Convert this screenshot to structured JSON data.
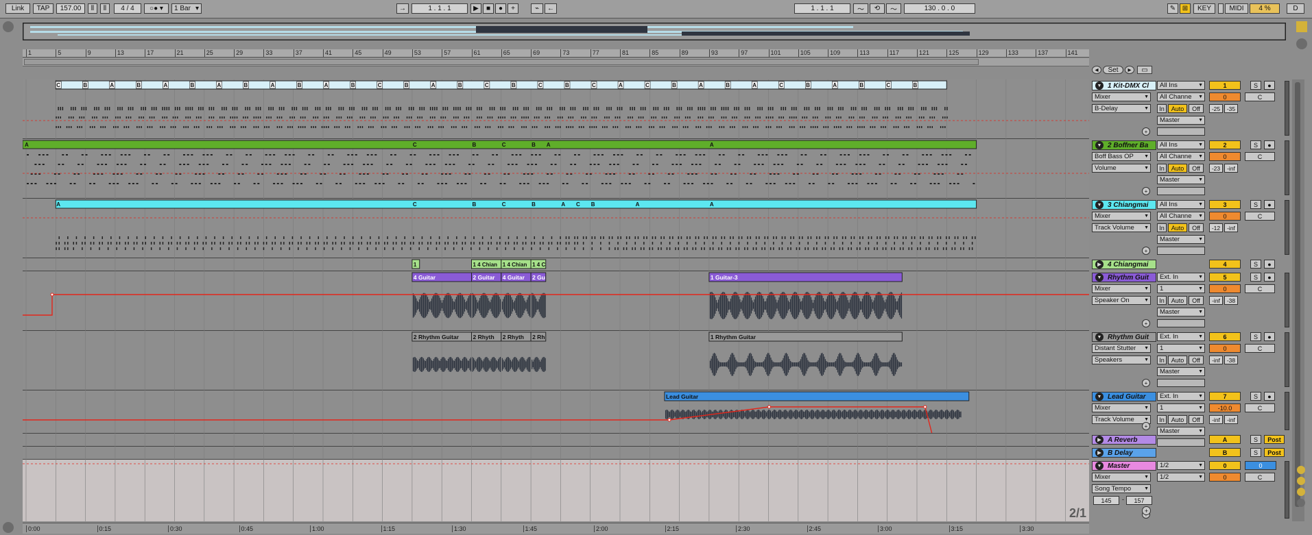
{
  "transport": {
    "link": "Link",
    "tap": "TAP",
    "tempo": "157.00",
    "signature": "4 / 4",
    "quantize": "1 Bar",
    "position": "1 .  1 .  1",
    "loop_start": "1 .  1 .  1",
    "loop_length": "130 .  0 .  0",
    "key": "KEY",
    "midi": "MIDI",
    "cpu": "4 %",
    "d": "D"
  },
  "ruler": {
    "bars": [
      "1",
      "5",
      "9",
      "13",
      "17",
      "21",
      "25",
      "29",
      "33",
      "37",
      "41",
      "45",
      "49",
      "53",
      "57",
      "61",
      "65",
      "69",
      "73",
      "77",
      "81",
      "85",
      "89",
      "93",
      "97",
      "101",
      "105",
      "109",
      "113",
      "117",
      "121",
      "125",
      "129",
      "133",
      "137",
      "141"
    ],
    "set_label": "Set"
  },
  "time_axis": [
    "0:00",
    "0:15",
    "0:30",
    "0:45",
    "1:00",
    "1:15",
    "1:30",
    "1:45",
    "2:00",
    "2:15",
    "2:30",
    "2:45",
    "3:00",
    "3:15",
    "3:30"
  ],
  "page_indicator": "2/1",
  "tracks": [
    {
      "name": "1 Kit-DMX Cl",
      "color": "#d8f0f8",
      "input": "All Ins",
      "channel": "All Channe",
      "device": "Mixer",
      "param": "B-Delay",
      "output": "Master",
      "number": "1",
      "vol": "0",
      "pan": "C",
      "vals": [
        "-25",
        "-35"
      ],
      "auto": "Auto",
      "in": "In",
      "off": "Off"
    },
    {
      "name": "2 Boffner Ba",
      "color": "#5fae2a",
      "input": "All Ins",
      "channel": "All Channe",
      "device": "Boff Bass OP",
      "param": "Volume",
      "output": "Master",
      "number": "2",
      "vol": "0",
      "pan": "C",
      "vals": [
        "-23",
        "-inf"
      ],
      "auto": "Auto",
      "in": "In",
      "off": "Off"
    },
    {
      "name": "3 Chiangmai",
      "color": "#5ce7f0",
      "input": "All Ins",
      "channel": "All Channe",
      "device": "Mixer",
      "param": "Track Volume",
      "output": "Master",
      "number": "3",
      "vol": "0",
      "pan": "C",
      "vals": [
        "-12",
        "-inf"
      ],
      "auto": "Auto",
      "in": "In",
      "off": "Off"
    },
    {
      "name": "4 Chiangmai",
      "color": "#a6e08a",
      "number": "4"
    },
    {
      "name": "Rhythm Guit",
      "color": "#8a5bd6",
      "input": "Ext. In",
      "channel": "1",
      "device": "Mixer",
      "param": "Speaker On",
      "output": "Master",
      "number": "5",
      "vol": "0",
      "pan": "C",
      "vals": [
        "-inf",
        "-38"
      ],
      "auto": "Auto",
      "in": "In",
      "off": "Off"
    },
    {
      "name": "Rhythm Guit",
      "color": "#9a9a9a",
      "input": "Ext. In",
      "channel": "1",
      "device": "Distant Stutter",
      "param": "Speakers",
      "output": "Master",
      "number": "6",
      "vol": "0",
      "pan": "C",
      "vals": [
        "-inf",
        "-38"
      ],
      "auto": "Auto",
      "in": "In",
      "off": "Off"
    },
    {
      "name": "Lead Guitar",
      "color": "#3b8fe0",
      "input": "Ext. In",
      "channel": "1",
      "device": "Mixer",
      "param": "Track Volume",
      "output": "Master",
      "number": "7",
      "vol": "-10.0",
      "pan": "C",
      "vals": [
        "-inf",
        "-inf"
      ],
      "auto": "Auto",
      "in": "In",
      "off": "Off"
    },
    {
      "name": "A Reverb",
      "color": "#b38ae6",
      "number": "A",
      "post": "Post"
    },
    {
      "name": "B Delay",
      "color": "#5aa2ea",
      "number": "B",
      "post": "Post"
    },
    {
      "name": "Master",
      "color": "#e889e0",
      "device": "Mixer",
      "param": "Song Tempo",
      "cue": "1/2",
      "out": "1/2",
      "number": "0",
      "vol": "0",
      "pan": "C",
      "tempo_min": "145",
      "tempo_max": "157"
    }
  ],
  "clips": {
    "t1_markers": [
      "C",
      "B",
      "A",
      "B",
      "A",
      "B",
      "A",
      "B",
      "A",
      "B",
      "A",
      "B",
      "C",
      "B",
      "A",
      "B",
      "C",
      "B",
      "C",
      "B",
      "C",
      "A",
      "C",
      "B",
      "A",
      "B",
      "A",
      "C",
      "B",
      "A",
      "B",
      "C",
      "B"
    ],
    "t2_markers": [
      "A",
      "C",
      "B",
      "C",
      "B",
      "A",
      "A"
    ],
    "t3_markers": [
      "A",
      "C",
      "B",
      "C",
      "B",
      "A",
      "C",
      "B",
      "A",
      "A"
    ],
    "t4_labels": [
      "1",
      "1 4 Chian",
      "1 4 Chian",
      "1 4 C"
    ],
    "t5_labels": [
      "4 Guitar",
      "2 Guitar",
      "4 Guitar",
      "2 Gu",
      "1 Guitar-3"
    ],
    "t6_labels": [
      "2 Rhythm Guitar",
      "2 Rhyth",
      "2 Rhyth",
      "2 Rh",
      "1 Rhythm Guitar"
    ],
    "t7_labels": [
      "Lead Guitar"
    ]
  },
  "colors": {
    "automation": "#e3261b",
    "waveform": "#2f3540",
    "track_number": "#f2c21b",
    "volume": "#ef8a2f"
  }
}
